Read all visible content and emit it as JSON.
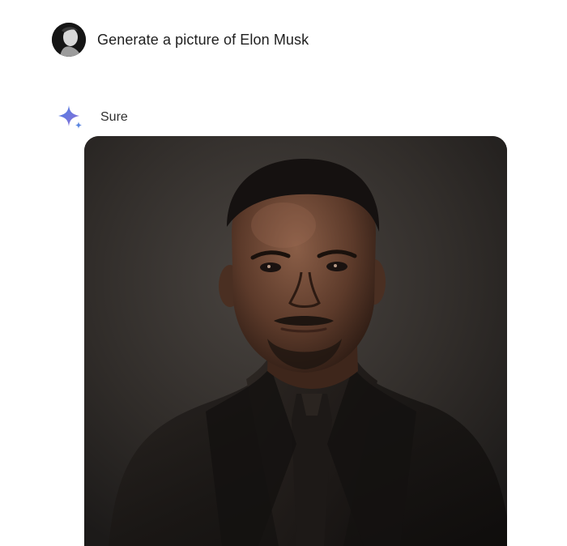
{
  "conversation": {
    "user_message": {
      "avatar_icon": "user-avatar-icon",
      "text": "Generate a picture of Elon Musk"
    },
    "assistant_reply": {
      "icon": "sparkle-icon",
      "text": "Sure"
    }
  },
  "colors": {
    "sparkle_blue": "#4a7fe6",
    "sparkle_purple": "#8f6ed5",
    "image_background": "#2b2725"
  }
}
